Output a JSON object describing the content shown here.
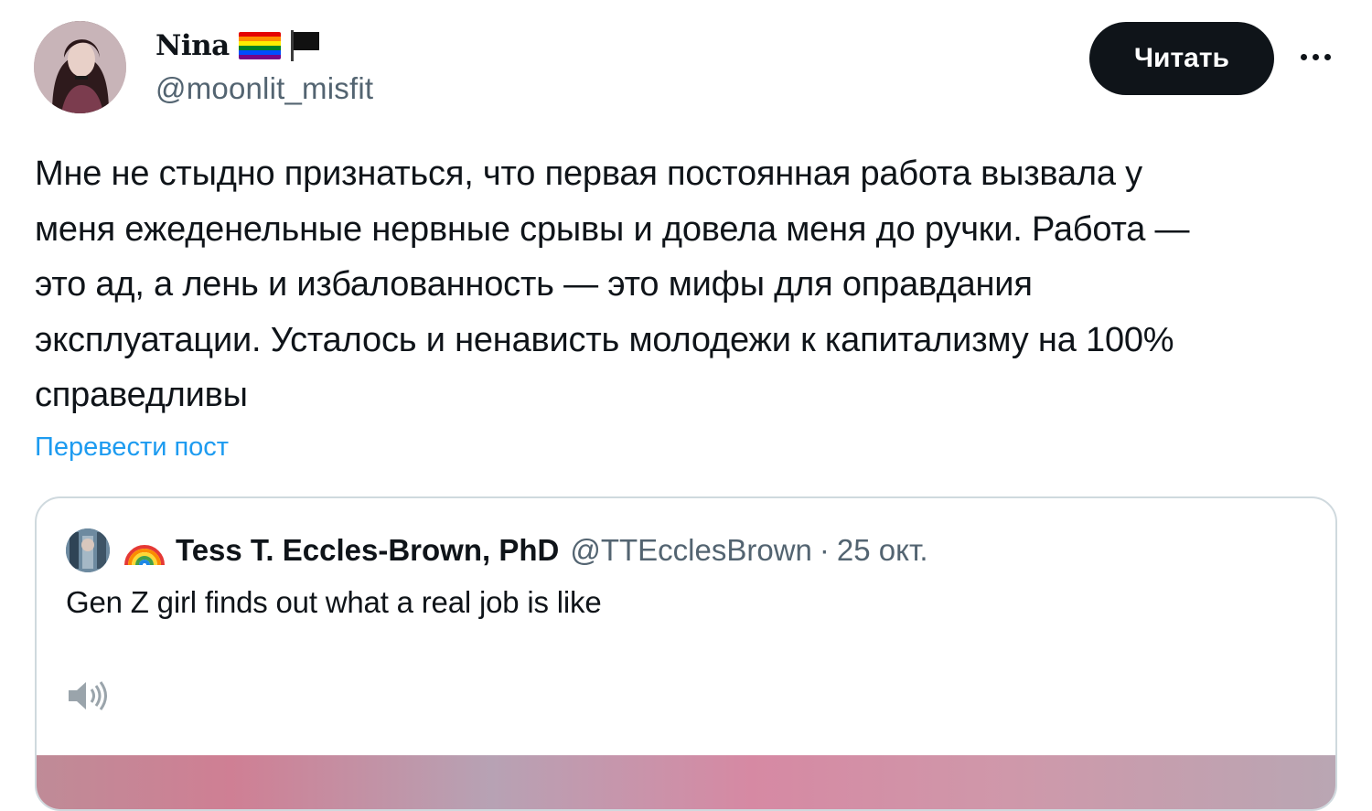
{
  "author": {
    "display_name": "Nina",
    "handle": "@moonlit_misfit",
    "flags": [
      "rainbow-flag-icon",
      "black-flag-icon"
    ]
  },
  "follow_button": {
    "label": "Читать"
  },
  "more_button": {
    "icon": "more-horizontal-icon"
  },
  "tweet": {
    "text": "Мне не стыдно признаться, что первая постоянная работа вызвала у\nменя ежеденельные нервные срывы и довела меня до ручки. Работа —\nэто ад, а лень и избалованность — это мифы для оправдания\nэксплуатации. Усталось и ненависть молодежи к капитализму на 100%\nсправедливы",
    "translate_label": "Перевести пост"
  },
  "quote": {
    "display_name": "Tess T. Eccles-Brown, PhD",
    "handle": "@TTEcclesBrown",
    "separator": "·",
    "date": "25 окт.",
    "text": "Gen Z girl finds out what a real job is like",
    "name_emoji": "rainbow-icon",
    "audio_icon": "speaker-icon"
  },
  "colors": {
    "text_primary": "#0f1419",
    "text_secondary": "#536471",
    "link": "#1d9bf0",
    "border": "#cfd9de",
    "button_bg": "#0f1419"
  }
}
